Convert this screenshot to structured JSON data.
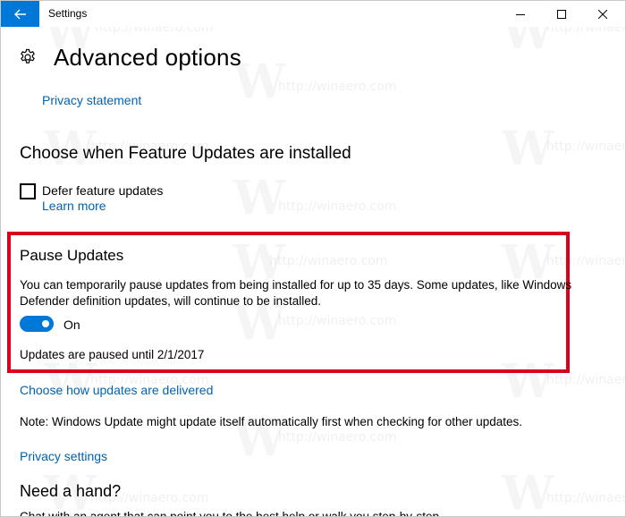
{
  "window": {
    "title": "Settings"
  },
  "header": {
    "page_title": "Advanced options"
  },
  "links": {
    "privacy_statement": "Privacy statement",
    "learn_more": "Learn more",
    "choose_delivery": "Choose how updates are delivered",
    "privacy_settings": "Privacy settings"
  },
  "feature_updates": {
    "title": "Choose when Feature Updates are installed",
    "defer_label": "Defer feature updates",
    "defer_checked": false
  },
  "pause_updates": {
    "title": "Pause Updates",
    "description_line1": "You can temporarily pause updates from being installed for up to 35 days. Some updates, like Windows",
    "description_line2": "Defender definition updates, will continue to be installed.",
    "toggle_label": "On",
    "toggle_on": true,
    "status": "Updates are paused until 2/1/2017"
  },
  "note": "Note: Windows Update might update itself automatically first when checking for other updates.",
  "help": {
    "title": "Need a hand?",
    "text": "Chat with an agent that can point you to the best help or walk you step-by-step"
  },
  "watermark": {
    "text": "http://winaero.com",
    "logo": "W"
  },
  "colors": {
    "accent": "#0078d7",
    "link": "#0063b1",
    "highlight": "#d9001b"
  }
}
